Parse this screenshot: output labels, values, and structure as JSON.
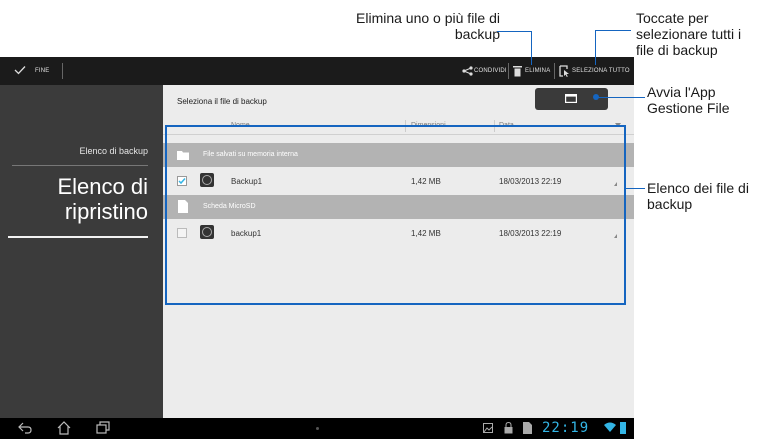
{
  "callouts": {
    "delete": [
      "Elimina uno o più file di",
      "backup"
    ],
    "select_all": [
      "Toccate per",
      "selezionare tutti i",
      "file di backup"
    ],
    "file_manager": [
      "Avvia l'App",
      "Gestione File"
    ],
    "backup_list": [
      "Elenco dei file di",
      "backup"
    ]
  },
  "actionbar": {
    "done": "FINE",
    "share": "CONDIVIDI",
    "delete": "ELIMINA",
    "select_all": "SELEZIONA TUTTO"
  },
  "sidebar": {
    "backup_list": "Elenco di backup",
    "restore_list_l1": "Elenco di",
    "restore_list_l2": "ripristino"
  },
  "content": {
    "header": "Seleziona il file di backup",
    "columns": [
      "Nome",
      "Dimensioni",
      "Data"
    ],
    "groups": [
      {
        "title": "File salvati su memoria interna",
        "rows": [
          {
            "name": "Backup1",
            "size": "1,42 MB",
            "date": "18/03/2013 22:19",
            "checked": true
          }
        ]
      },
      {
        "title": "Scheda MicroSD",
        "rows": [
          {
            "name": "backup1",
            "size": "1,42 MB",
            "date": "18/03/2013 22:19",
            "checked": false
          }
        ]
      }
    ]
  },
  "statusbar": {
    "time": "22:19"
  },
  "colors": {
    "accent": "#1565c0",
    "status_blue": "#33b5e5"
  }
}
